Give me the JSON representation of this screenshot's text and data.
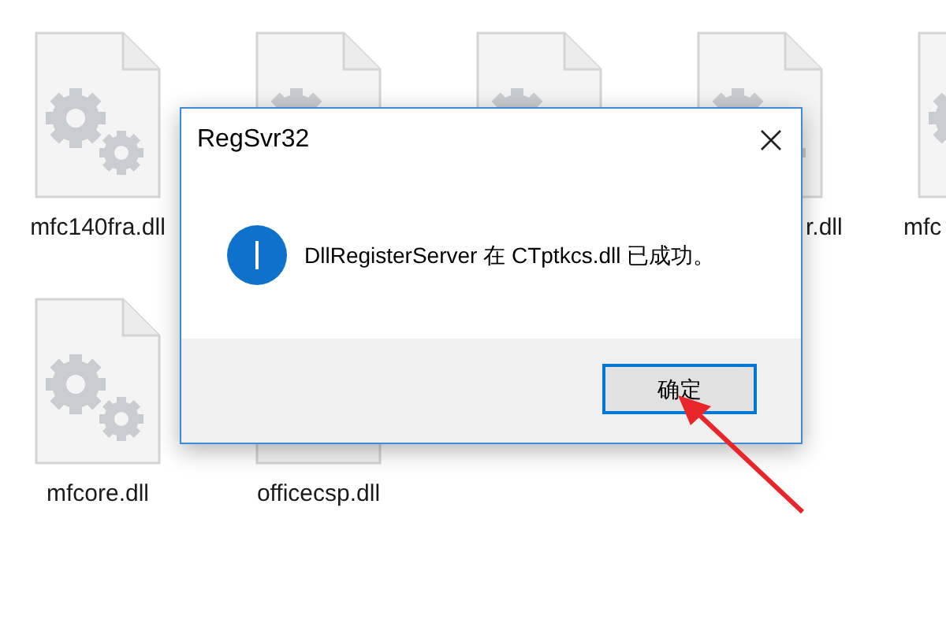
{
  "files": [
    {
      "kind": "named",
      "label": "mfc140fra.dll"
    },
    {
      "kind": "covered"
    },
    {
      "kind": "covered"
    },
    {
      "kind": "named",
      "label": "r.dll"
    },
    {
      "kind": "named",
      "label": "mfc"
    },
    {
      "kind": "named",
      "label": "mfcore.dll"
    },
    {
      "kind": "named",
      "label": "officecsp.dll"
    }
  ],
  "dialog": {
    "title": "RegSvr32",
    "message": "DllRegisterServer 在 CTptkcs.dll 已成功。",
    "buttons": [
      {
        "label": "确定",
        "focused": true
      }
    ]
  }
}
